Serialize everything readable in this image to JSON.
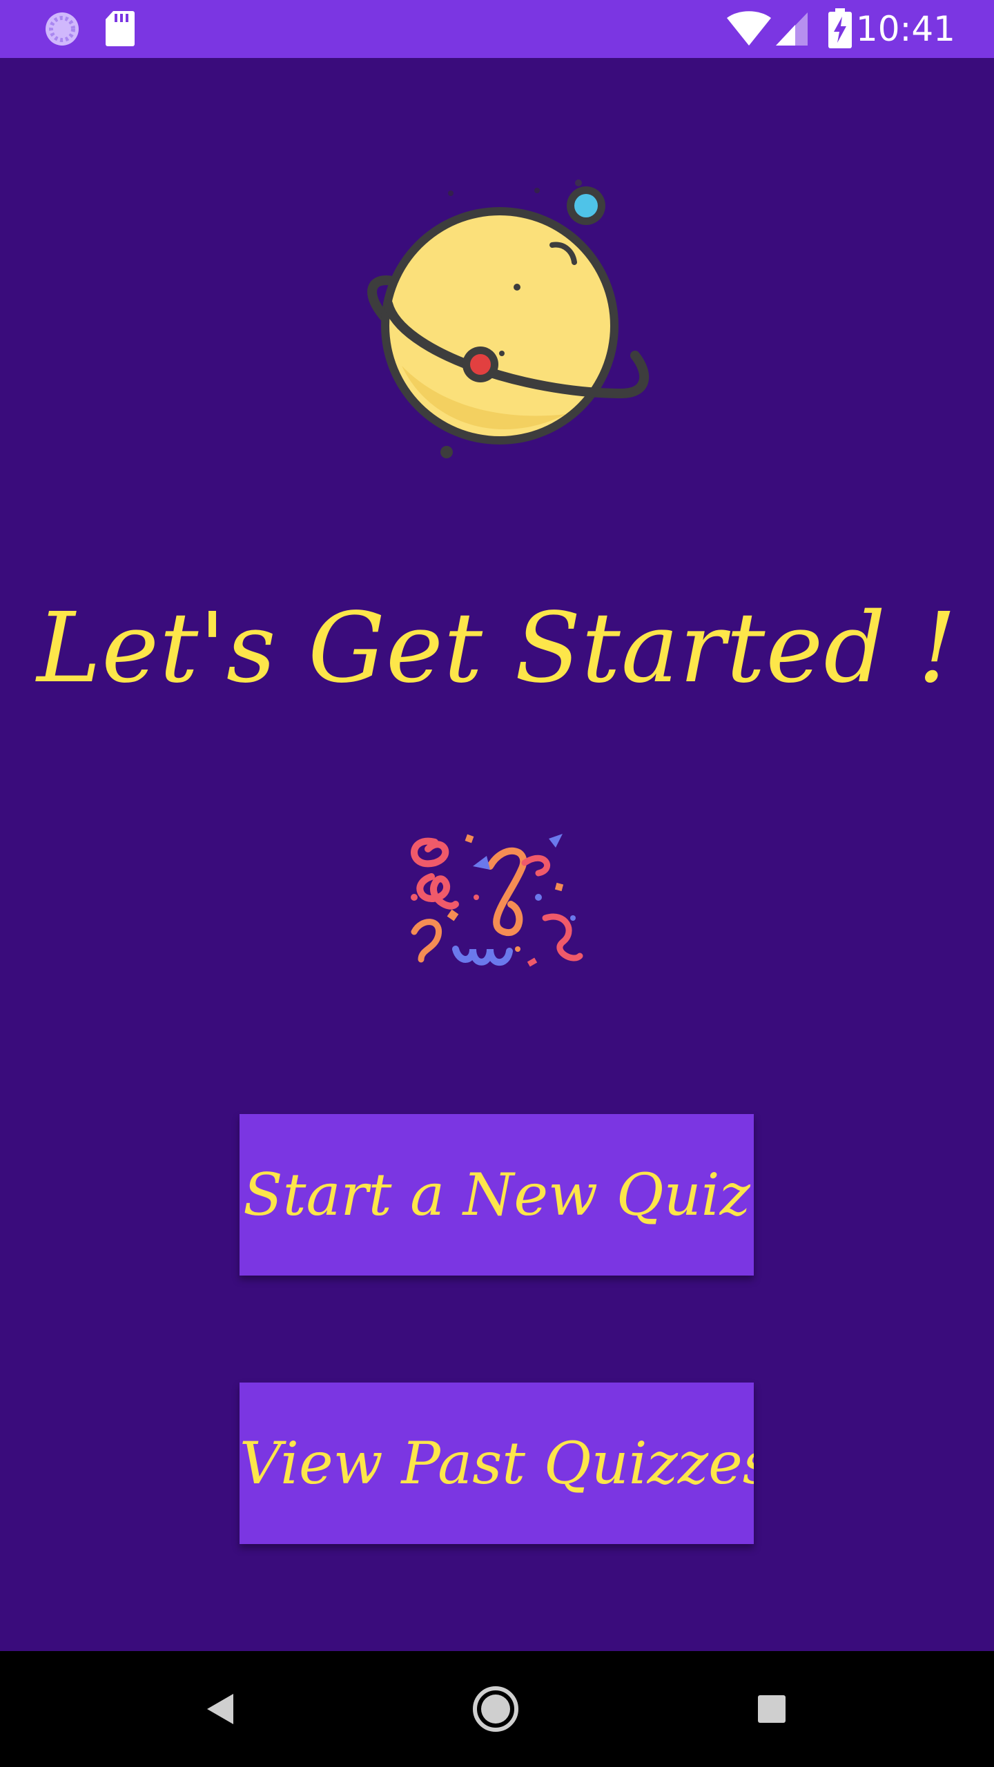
{
  "status_bar": {
    "time": "10:41",
    "left_icons": [
      "loading-icon",
      "sd-card-icon"
    ],
    "right_icons": [
      "wifi-icon",
      "signal-icon",
      "battery-charging-icon"
    ]
  },
  "hero": {
    "icon": "planet-icon",
    "headline": "Let's Get Started !",
    "decoration_icon": "confetti-icon"
  },
  "actions": {
    "new_quiz_label": "Start a New Quiz",
    "past_quizzes_label": "View Past Quizzes"
  },
  "nav_bar": {
    "icons": [
      "back-icon",
      "home-icon",
      "recent-apps-icon"
    ]
  },
  "colors": {
    "background": "#3a0c7c",
    "primary": "#7b36e2",
    "accent_text": "#fde64a",
    "nav_bar": "#000000"
  }
}
